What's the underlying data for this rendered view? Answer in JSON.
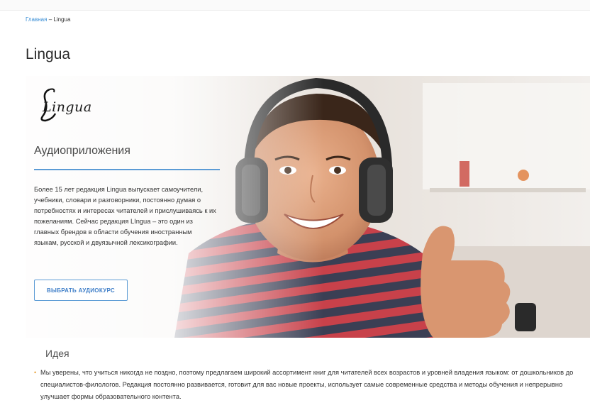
{
  "breadcrumb": {
    "home_label": "Главная",
    "separator": "–",
    "current": "Lingua"
  },
  "page": {
    "title": "Lingua"
  },
  "hero": {
    "logo_text": "Lingua",
    "heading": "Аудиоприложения",
    "description": "Более 15 лет редакция Lingua выпускает самоучители, учебники, словари и разговорники, постоянно думая о потребностях и интересах читателей и прислушиваясь к их пожеланиям. Сейчас редакция LIngua – это один из главных брендов в области обучения иностранным языкам, русской и двуязычной лексикографии.",
    "cta_label": "ВЫБРАТЬ АУДИОКУРС"
  },
  "idea": {
    "heading": "Идея",
    "text": "Мы уверены, что учиться никогда не поздно, поэтому предлагаем широкий ассортимент книг для читателей всех возрастов и уровней владения языком: от дошкольников до специалистов-филологов. Редакция постоянно развивается, готовит для вас новые проекты, использует самые современные средства и методы обучения и непрерывно улучшает формы образовательного контента."
  },
  "colors": {
    "link": "#3b8fd6",
    "accent": "#5b9bd5",
    "bullet": "#e8a23a"
  }
}
